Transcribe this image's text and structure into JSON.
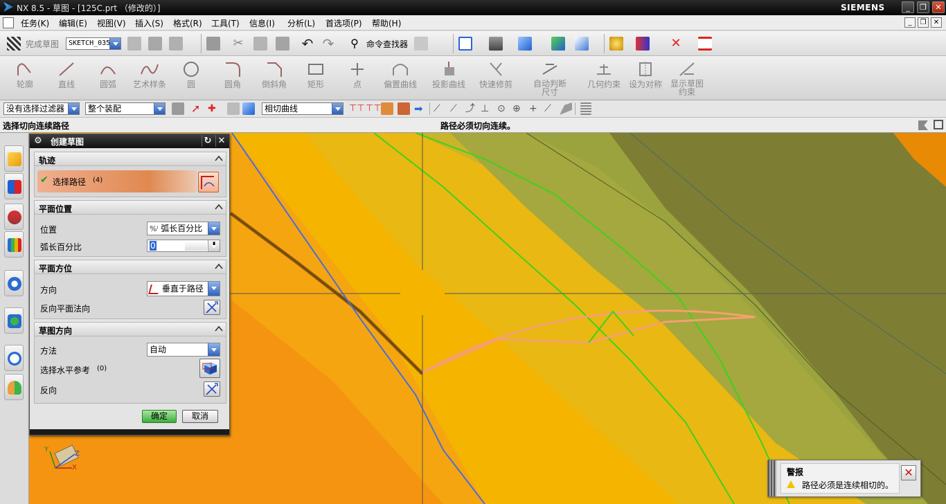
{
  "window": {
    "title": "NX 8.5 - 草图 - [125C.prt （修改的）]",
    "brand": "SIEMENS",
    "buttons": [
      "_",
      "❐",
      "✕"
    ]
  },
  "menu": {
    "items": [
      "任务(K)",
      "编辑(E)",
      "视图(V)",
      "插入(S)",
      "格式(R)",
      "工具(T)",
      "信息(I)",
      "分析(L)",
      "首选项(P)",
      "帮助(H)"
    ]
  },
  "toolbar1": {
    "finish_sketch": "完成草图",
    "sketch_name": "SKETCH_035",
    "command_finder": "命令查找器"
  },
  "ribbon": {
    "items": [
      {
        "label": "轮廓",
        "icon": "profile-icon"
      },
      {
        "label": "直线",
        "icon": "line-icon"
      },
      {
        "label": "圆弧",
        "icon": "arc-icon"
      },
      {
        "label": "艺术样条",
        "icon": "studio-spline-icon"
      },
      {
        "label": "圆",
        "icon": "circle-icon"
      },
      {
        "label": "圆角",
        "icon": "fillet-icon"
      },
      {
        "label": "倒斜角",
        "icon": "chamfer-icon"
      },
      {
        "label": "矩形",
        "icon": "rectangle-icon"
      },
      {
        "label": "点",
        "icon": "point-icon"
      },
      {
        "label": "偏置曲线",
        "icon": "offset-curve-icon"
      },
      {
        "label": "投影曲线",
        "icon": "project-curve-icon"
      },
      {
        "label": "快速修剪",
        "icon": "quick-trim-icon"
      },
      {
        "label": "自动判断尺寸",
        "icon": "inferred-dimension-icon"
      },
      {
        "label": "几何约束",
        "icon": "geometric-constraint-icon"
      },
      {
        "label": "设为对称",
        "icon": "make-symmetric-icon"
      },
      {
        "label": "显示草图约束",
        "icon": "show-constraints-icon"
      }
    ]
  },
  "filterbar": {
    "type_filter": "没有选择过滤器",
    "scope": "整个装配",
    "curve_rule": "相切曲线"
  },
  "cue": {
    "left": "选择切向连续路径",
    "right": "路径必须切向连续。"
  },
  "dialog": {
    "title": "创建草图",
    "sections": {
      "path": {
        "header": "轨迹",
        "select_label": "选择路径",
        "count": "(4)"
      },
      "plane_location": {
        "header": "平面位置",
        "location_label": "位置",
        "location_value": "弧长百分比",
        "percent_label": "弧长百分比",
        "percent_value": "0"
      },
      "plane_orientation": {
        "header": "平面方位",
        "direction_label": "方向",
        "direction_value": "垂直于路径",
        "reverse_label": "反向平面法向"
      },
      "sketch_orientation": {
        "header": "草图方向",
        "method_label": "方法",
        "method_value": "自动",
        "horizontal_ref_label": "选择水平参考",
        "horizontal_ref_count": "(0)",
        "reverse_label": "反向"
      }
    },
    "ok": "确定",
    "cancel": "取消"
  },
  "alert": {
    "title": "警报",
    "message": "路径必须是连续相切的。"
  },
  "colors": {
    "canvas_orange": "#f4b400",
    "dark_orange": "#f49410",
    "olive": "#99a040",
    "dark_olive": "#7b7d33",
    "highlight_green": "#3fd11f",
    "blue_curve": "#4a6fd8",
    "salmon_curve": "#f5a070"
  }
}
